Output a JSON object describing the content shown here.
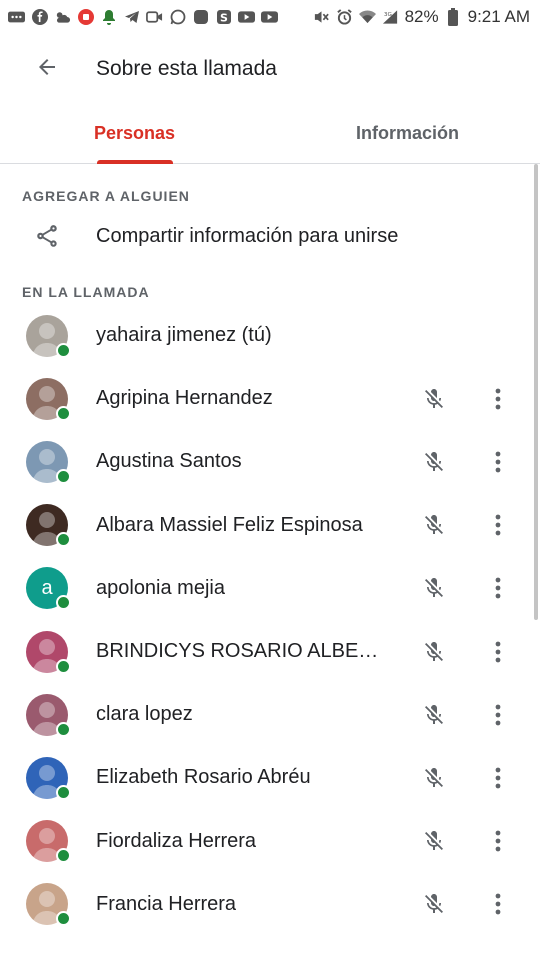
{
  "status_bar": {
    "battery": "82%",
    "time": "9:21 AM",
    "left_icons": [
      "more-apps-icon",
      "facebook-icon",
      "weather-icon",
      "record-icon",
      "bell-icon",
      "telegram-icon",
      "video-icon",
      "whatsapp-icon",
      "app-icon",
      "app-s-icon",
      "youtube-icon",
      "youtube-icon"
    ],
    "right_icons": [
      "mute-icon",
      "alarm-icon",
      "wifi-icon",
      "signal-icon",
      "battery-icon"
    ]
  },
  "header": {
    "title": "Sobre esta llamada"
  },
  "tabs": [
    {
      "label": "Personas",
      "active": true
    },
    {
      "label": "Información",
      "active": false
    }
  ],
  "add_section": {
    "label": "AGREGAR A ALGUIEN",
    "share_label": "Compartir información para unirse"
  },
  "call_section": {
    "label": "EN LA LLAMADA",
    "people": [
      {
        "name": "yahaira jimenez (tú)",
        "avatar": "photo",
        "avatar_color": "#a9a39b",
        "self": true
      },
      {
        "name": "Agripina Hernandez",
        "avatar": "photo",
        "avatar_color": "#8d6e63"
      },
      {
        "name": "Agustina Santos",
        "avatar": "photo",
        "avatar_color": "#7d98b3"
      },
      {
        "name": "Albara Massiel Feliz Espinosa",
        "avatar": "photo",
        "avatar_color": "#3e2a22"
      },
      {
        "name": "apolonia mejia",
        "avatar": "letter",
        "letter": "a",
        "avatar_color": "#0f9d8c"
      },
      {
        "name": "BRINDICYS ROSARIO ALBER...",
        "avatar": "photo",
        "avatar_color": "#b0486a"
      },
      {
        "name": "clara lopez",
        "avatar": "photo",
        "avatar_color": "#9a5a6e"
      },
      {
        "name": "Elizabeth Rosario Abréu",
        "avatar": "photo",
        "avatar_color": "#2f64b8"
      },
      {
        "name": "Fiordaliza Herrera",
        "avatar": "photo",
        "avatar_color": "#c86b6b"
      },
      {
        "name": "Francia Herrera",
        "avatar": "photo",
        "avatar_color": "#c8a48a"
      }
    ]
  },
  "colors": {
    "accent": "#d93025",
    "online": "#1e8e3e",
    "icon": "#5f6368"
  }
}
